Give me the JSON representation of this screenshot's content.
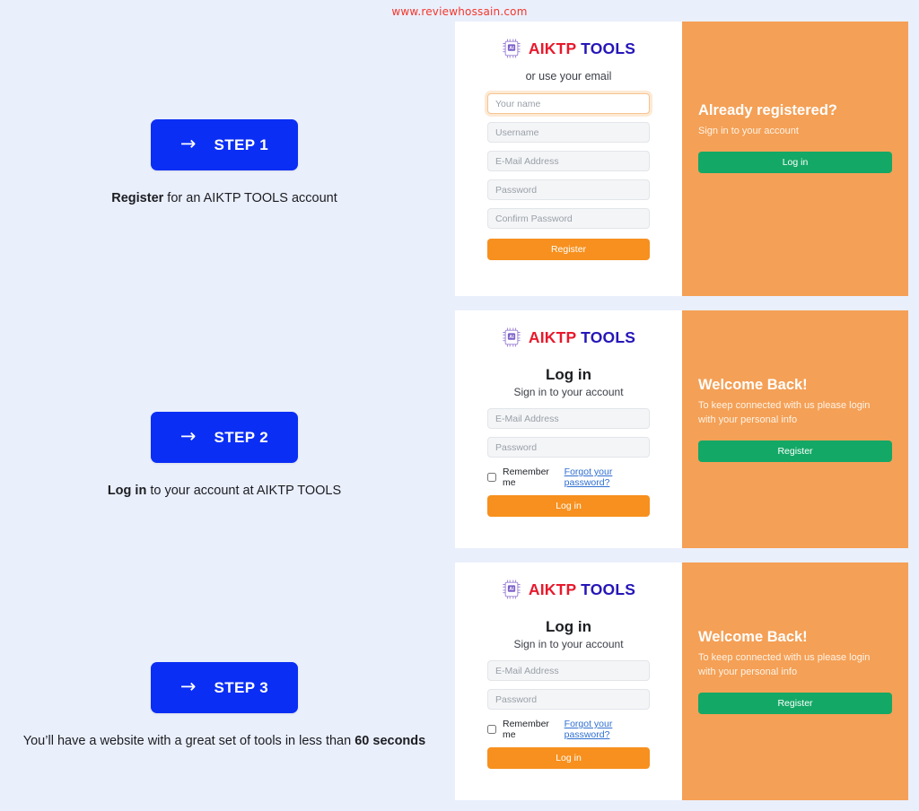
{
  "watermark": "www.reviewhossain.com",
  "brand": {
    "part_one": "AIKTP",
    "part_two": "TOOLS",
    "icon": "ai-chip-icon",
    "color_primary": "#e8192c",
    "color_secondary": "#2516b8"
  },
  "colors": {
    "page_background": "#eaeffc",
    "step_button": "#0b2ef5",
    "panel_orange": "#f4a056",
    "button_orange": "#f7901e",
    "button_green": "#14a866",
    "watermark_red": "#f4362a",
    "link_blue": "#2f6fd0"
  },
  "steps": [
    {
      "button_label": "STEP 1",
      "arrow_icon": "arrow-right-icon",
      "caption_bold": "Register",
      "caption_rest": " for an AIKTP TOOLS account"
    },
    {
      "button_label": "STEP 2",
      "arrow_icon": "arrow-right-icon",
      "caption_bold": "Log in",
      "caption_rest": " to your account at AIKTP TOOLS"
    },
    {
      "button_label": "STEP 3",
      "arrow_icon": "arrow-right-icon",
      "caption_lead": "You’ll have a website with a great set of tools in less than ",
      "caption_bold": "60 seconds"
    }
  ],
  "register_card": {
    "or_use_email": "or use your email",
    "fields": [
      {
        "placeholder": "Your name",
        "focused": true
      },
      {
        "placeholder": "Username",
        "focused": false
      },
      {
        "placeholder": "E-Mail Address",
        "focused": false
      },
      {
        "placeholder": "Password",
        "focused": false
      },
      {
        "placeholder": "Confirm Password",
        "focused": false
      }
    ],
    "submit_label": "Register",
    "panel": {
      "title": "Already registered?",
      "subtitle": "Sign in to your account",
      "button_label": "Log in"
    }
  },
  "login_card": {
    "title": "Log in",
    "subtitle": "Sign in to your account",
    "fields": [
      {
        "placeholder": "E-Mail Address"
      },
      {
        "placeholder": "Password"
      }
    ],
    "remember_label": "Remember me",
    "forgot_label": "Forgot your password?",
    "submit_label": "Log in",
    "panel": {
      "title": "Welcome Back!",
      "subtitle": "To keep connected with us please login with your personal info",
      "button_label": "Register"
    }
  }
}
